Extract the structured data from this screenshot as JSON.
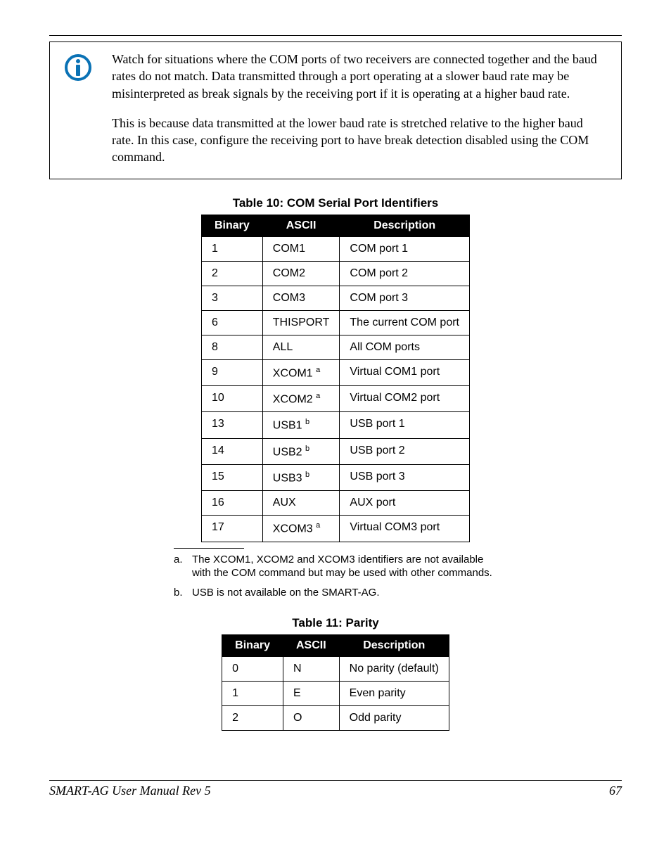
{
  "note": {
    "p1": "Watch for situations where the COM ports of two receivers are connected together and the baud rates do not match. Data transmitted through a port operating at a slower baud rate may be misinterpreted as break signals by the receiving port if it is operating at a higher baud rate.",
    "p2": "This is because data transmitted at the lower baud rate is stretched relative to the higher baud rate. In this case, configure the receiving port to have break detection disabled using the COM command."
  },
  "table10": {
    "caption": "Table 10:  COM Serial Port Identifiers",
    "headers": {
      "binary": "Binary",
      "ascii": "ASCII",
      "description": "Description"
    },
    "rows": [
      {
        "binary": "1",
        "ascii": "COM1",
        "sup": "",
        "desc": "COM port 1"
      },
      {
        "binary": "2",
        "ascii": "COM2",
        "sup": "",
        "desc": "COM port 2"
      },
      {
        "binary": "3",
        "ascii": "COM3",
        "sup": "",
        "desc": "COM port 3"
      },
      {
        "binary": "6",
        "ascii": "THISPORT",
        "sup": "",
        "desc": "The current COM port"
      },
      {
        "binary": "8",
        "ascii": "ALL",
        "sup": "",
        "desc": "All COM ports"
      },
      {
        "binary": "9",
        "ascii": "XCOM1",
        "sup": "a",
        "desc": "Virtual COM1 port"
      },
      {
        "binary": "10",
        "ascii": "XCOM2",
        "sup": "a",
        "desc": "Virtual COM2 port"
      },
      {
        "binary": "13",
        "ascii": "USB1",
        "sup": "b",
        "desc": "USB port 1"
      },
      {
        "binary": "14",
        "ascii": "USB2",
        "sup": "b",
        "desc": "USB port 2"
      },
      {
        "binary": "15",
        "ascii": "USB3",
        "sup": "b",
        "desc": "USB port 3"
      },
      {
        "binary": "16",
        "ascii": "AUX",
        "sup": "",
        "desc": "AUX port"
      },
      {
        "binary": "17",
        "ascii": "XCOM3",
        "sup": "a",
        "desc": "Virtual COM3 port"
      }
    ]
  },
  "footnotes": {
    "a_label": "a.",
    "a_text": "The XCOM1, XCOM2 and XCOM3 identifiers are not available with the COM command but may be used with other commands.",
    "b_label": "b.",
    "b_text": "USB is not available on the SMART-AG."
  },
  "table11": {
    "caption": "Table 11:  Parity",
    "headers": {
      "binary": "Binary",
      "ascii": "ASCII",
      "description": "Description"
    },
    "rows": [
      {
        "binary": "0",
        "ascii": "N",
        "desc": "No parity (default)"
      },
      {
        "binary": "1",
        "ascii": "E",
        "desc": "Even parity"
      },
      {
        "binary": "2",
        "ascii": "O",
        "desc": "Odd parity"
      }
    ]
  },
  "footer": {
    "left": "SMART-AG User Manual Rev 5",
    "right": "67"
  }
}
